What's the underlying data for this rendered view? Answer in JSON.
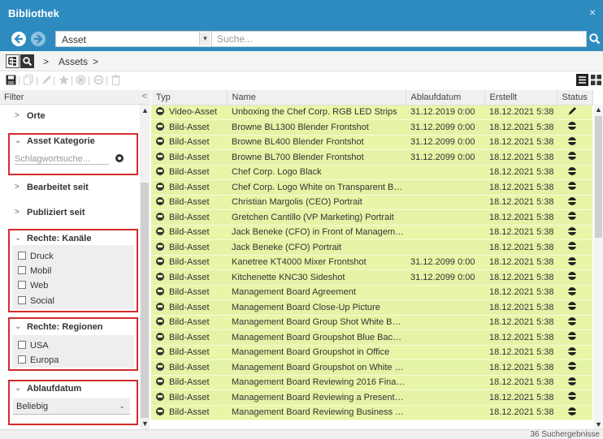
{
  "window": {
    "title": "Bibliothek",
    "close_label": "×"
  },
  "search": {
    "type_value": "Asset",
    "placeholder": "Suche..."
  },
  "breadcrumb": {
    "separator_1": ">",
    "item": "Assets",
    "separator_2": ">"
  },
  "filter": {
    "header": "Filter",
    "collapse_label": "<",
    "sections": {
      "orte": {
        "chevron": ">",
        "label": "Orte"
      },
      "asset_kategorie": {
        "chevron": "⌄",
        "label": "Asset Kategorie",
        "input_placeholder": "Schlagwortsuche..."
      },
      "bearbeitet_seit": {
        "chevron": ">",
        "label": "Bearbeitet seit"
      },
      "publiziert_seit": {
        "chevron": ">",
        "label": "Publiziert seit"
      },
      "rechte_kanaele": {
        "chevron": "⌄",
        "label": "Rechte: Kanäle",
        "options": [
          "Druck",
          "Mobil",
          "Web",
          "Social"
        ]
      },
      "rechte_regionen": {
        "chevron": "⌄",
        "label": "Rechte: Regionen",
        "options": [
          "USA",
          "Europa"
        ]
      },
      "ablaufdatum": {
        "chevron": "⌄",
        "label": "Ablaufdatum",
        "select_value": "Beliebig"
      }
    }
  },
  "table": {
    "columns": [
      "Typ",
      "Name",
      "Ablaufdatum",
      "Erstellt",
      "Status"
    ],
    "rows": [
      {
        "typ": "Video-Asset",
        "name": "Unboxing the Chef Corp. RGB LED Strips",
        "ablauf": "31.12.2019 0:00",
        "erstellt": "18.12.2021 5:38",
        "status": "pencil"
      },
      {
        "typ": "Bild-Asset",
        "name": "Browne BL1300 Blender Frontshot",
        "ablauf": "31.12.2099 0:00",
        "erstellt": "18.12.2021 5:38",
        "status": "globe"
      },
      {
        "typ": "Bild-Asset",
        "name": "Browne BL400 Blender Frontshot",
        "ablauf": "31.12.2099 0:00",
        "erstellt": "18.12.2021 5:38",
        "status": "globe"
      },
      {
        "typ": "Bild-Asset",
        "name": "Browne BL700 Blender Frontshot",
        "ablauf": "31.12.2099 0:00",
        "erstellt": "18.12.2021 5:38",
        "status": "globe"
      },
      {
        "typ": "Bild-Asset",
        "name": "Chef Corp. Logo Black",
        "ablauf": "",
        "erstellt": "18.12.2021 5:38",
        "status": "globe"
      },
      {
        "typ": "Bild-Asset",
        "name": "Chef Corp. Logo White on Transparent Back...",
        "ablauf": "",
        "erstellt": "18.12.2021 5:38",
        "status": "globe"
      },
      {
        "typ": "Bild-Asset",
        "name": "Christian Margolis (CEO) Portrait",
        "ablauf": "",
        "erstellt": "18.12.2021 5:38",
        "status": "globe"
      },
      {
        "typ": "Bild-Asset",
        "name": "Gretchen Cantillo (VP Marketing) Portrait",
        "ablauf": "",
        "erstellt": "18.12.2021 5:38",
        "status": "globe"
      },
      {
        "typ": "Bild-Asset",
        "name": "Jack Beneke (CFO) in Front of Management ...",
        "ablauf": "",
        "erstellt": "18.12.2021 5:38",
        "status": "globe"
      },
      {
        "typ": "Bild-Asset",
        "name": "Jack Beneke (CFO) Portrait",
        "ablauf": "",
        "erstellt": "18.12.2021 5:38",
        "status": "globe"
      },
      {
        "typ": "Bild-Asset",
        "name": "Kanetree KT4000 Mixer Frontshot",
        "ablauf": "31.12.2099 0:00",
        "erstellt": "18.12.2021 5:38",
        "status": "globe"
      },
      {
        "typ": "Bild-Asset",
        "name": "Kitchenette KNC30 Sideshot",
        "ablauf": "31.12.2099 0:00",
        "erstellt": "18.12.2021 5:38",
        "status": "globe"
      },
      {
        "typ": "Bild-Asset",
        "name": "Management Board Agreement",
        "ablauf": "",
        "erstellt": "18.12.2021 5:38",
        "status": "globe"
      },
      {
        "typ": "Bild-Asset",
        "name": "Management Board Close-Up Picture",
        "ablauf": "",
        "erstellt": "18.12.2021 5:38",
        "status": "globe"
      },
      {
        "typ": "Bild-Asset",
        "name": "Management Board Group Shot White Backg...",
        "ablauf": "",
        "erstellt": "18.12.2021 5:38",
        "status": "globe"
      },
      {
        "typ": "Bild-Asset",
        "name": "Management Board Groupshot Blue Backgro...",
        "ablauf": "",
        "erstellt": "18.12.2021 5:38",
        "status": "globe"
      },
      {
        "typ": "Bild-Asset",
        "name": "Management Board Groupshot in Office",
        "ablauf": "",
        "erstellt": "18.12.2021 5:38",
        "status": "globe"
      },
      {
        "typ": "Bild-Asset",
        "name": "Management Board Groupshot on White Bac...",
        "ablauf": "",
        "erstellt": "18.12.2021 5:38",
        "status": "globe"
      },
      {
        "typ": "Bild-Asset",
        "name": "Management Board Reviewing 2016 Financi...",
        "ablauf": "",
        "erstellt": "18.12.2021 5:38",
        "status": "globe"
      },
      {
        "typ": "Bild-Asset",
        "name": "Management Board Reviewing a Presentation",
        "ablauf": "",
        "erstellt": "18.12.2021 5:38",
        "status": "globe"
      },
      {
        "typ": "Bild-Asset",
        "name": "Management Board Reviewing Business Pro...",
        "ablauf": "",
        "erstellt": "18.12.2021 5:38",
        "status": "globe"
      }
    ]
  },
  "status_bar": {
    "count": "36 Suchergebnisse"
  },
  "colors": {
    "header_blue": "#2d8bc0",
    "row_green": "#e8f6a8",
    "highlight_red": "#d32c2c"
  },
  "icons": {
    "nav_back": "back-circle-icon",
    "nav_forward": "forward-circle-icon",
    "search": "search-icon",
    "tree": "tree-icon",
    "save": "save-icon",
    "view_list": "list-view-icon",
    "view_grid": "grid-view-icon",
    "status_edit": "pencil-icon",
    "status_published": "globe-icon"
  }
}
